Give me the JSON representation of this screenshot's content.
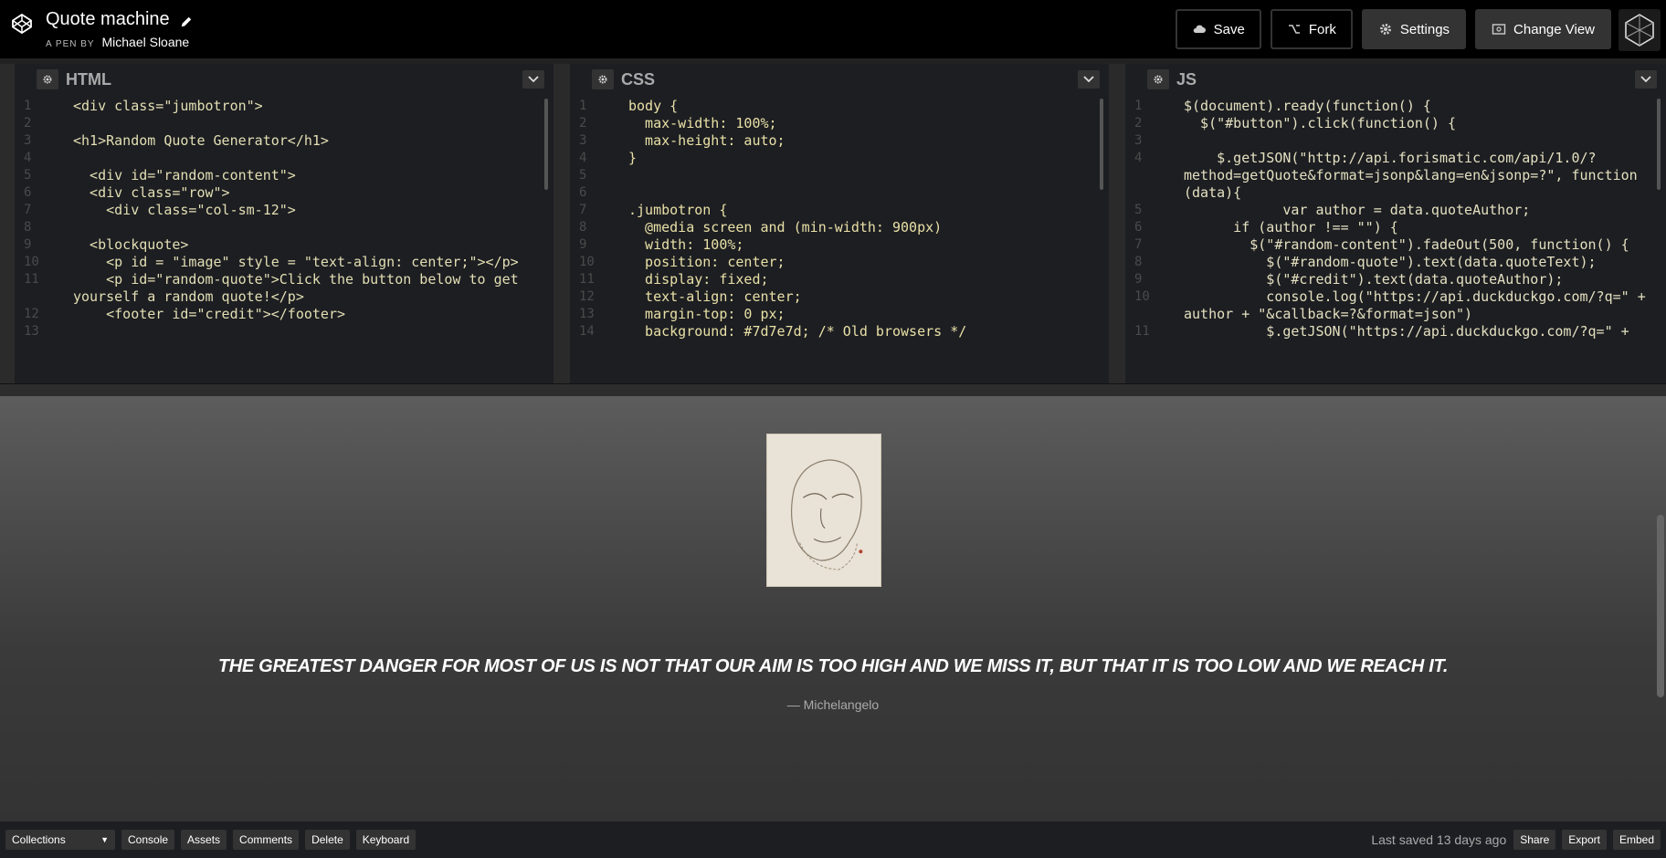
{
  "header": {
    "title": "Quote machine",
    "by_prefix": "A PEN BY",
    "author": "Michael Sloane",
    "buttons": {
      "save": "Save",
      "fork": "Fork",
      "settings": "Settings",
      "change_view": "Change View"
    }
  },
  "editors": {
    "html": {
      "title": "HTML",
      "lines": [
        {
          "n": "1",
          "code": "<div class=\"jumbotron\">"
        },
        {
          "n": "2",
          "code": ""
        },
        {
          "n": "3",
          "code": "<h1>Random Quote Generator</h1>"
        },
        {
          "n": "4",
          "code": ""
        },
        {
          "n": "5",
          "code": "  <div id=\"random-content\">"
        },
        {
          "n": "6",
          "code": "  <div class=\"row\">"
        },
        {
          "n": "7",
          "code": "    <div class=\"col-sm-12\">"
        },
        {
          "n": "8",
          "code": ""
        },
        {
          "n": "9",
          "code": "  <blockquote>"
        },
        {
          "n": "10",
          "code": "    <p id = \"image\" style = \"text-align: center;\"></p>"
        },
        {
          "n": "11",
          "code": "    <p id=\"random-quote\">Click the button below to get"
        },
        {
          "n": "",
          "code": "yourself a random quote!</p>"
        },
        {
          "n": "12",
          "code": "    <footer id=\"credit\"></footer>"
        },
        {
          "n": "13",
          "code": ""
        }
      ]
    },
    "css": {
      "title": "CSS",
      "lines": [
        {
          "n": "1",
          "code": "body {"
        },
        {
          "n": "2",
          "code": "  max-width: 100%;"
        },
        {
          "n": "3",
          "code": "  max-height: auto;"
        },
        {
          "n": "4",
          "code": "}"
        },
        {
          "n": "5",
          "code": ""
        },
        {
          "n": "6",
          "code": ""
        },
        {
          "n": "7",
          "code": ".jumbotron {"
        },
        {
          "n": "8",
          "code": "  @media screen and (min-width: 900px)"
        },
        {
          "n": "9",
          "code": "  width: 100%;"
        },
        {
          "n": "10",
          "code": "  position: center;"
        },
        {
          "n": "11",
          "code": "  display: fixed;"
        },
        {
          "n": "12",
          "code": "  text-align: center;"
        },
        {
          "n": "13",
          "code": "  margin-top: 0 px;"
        },
        {
          "n": "14",
          "code": "  background: #7d7e7d; /* Old browsers */"
        }
      ]
    },
    "js": {
      "title": "JS",
      "lines": [
        {
          "n": "1",
          "code": "$(document).ready(function() {"
        },
        {
          "n": "2",
          "code": "  $(\"#button\").click(function() {"
        },
        {
          "n": "3",
          "code": ""
        },
        {
          "n": "4",
          "code": "    $.getJSON(\"http://api.forismatic.com/api/1.0/?"
        },
        {
          "n": "",
          "code": "method=getQuote&format=jsonp&lang=en&jsonp=?\", function"
        },
        {
          "n": "",
          "code": "(data){"
        },
        {
          "n": "5",
          "code": "            var author = data.quoteAuthor;"
        },
        {
          "n": "6",
          "code": "      if (author !== \"\") {"
        },
        {
          "n": "7",
          "code": "        $(\"#random-content\").fadeOut(500, function() {"
        },
        {
          "n": "8",
          "code": "          $(\"#random-quote\").text(data.quoteText);"
        },
        {
          "n": "9",
          "code": "          $(\"#credit\").text(data.quoteAuthor);"
        },
        {
          "n": "10",
          "code": "          console.log(\"https://api.duckduckgo.com/?q=\" +"
        },
        {
          "n": "",
          "code": "author + \"&callback=?&format=json\")"
        },
        {
          "n": "11",
          "code": "          $.getJSON(\"https://api.duckduckgo.com/?q=\" +"
        }
      ]
    }
  },
  "preview": {
    "quote": "THE GREATEST DANGER FOR MOST OF US IS NOT THAT OUR AIM IS TOO HIGH AND WE MISS IT, BUT THAT IT IS TOO LOW AND WE REACH IT.",
    "credit": "— Michelangelo"
  },
  "footer": {
    "collections": "Collections",
    "console": "Console",
    "assets": "Assets",
    "comments": "Comments",
    "delete": "Delete",
    "keyboard": "Keyboard",
    "last_saved": "Last saved 13 days ago",
    "share": "Share",
    "export": "Export",
    "embed": "Embed"
  }
}
